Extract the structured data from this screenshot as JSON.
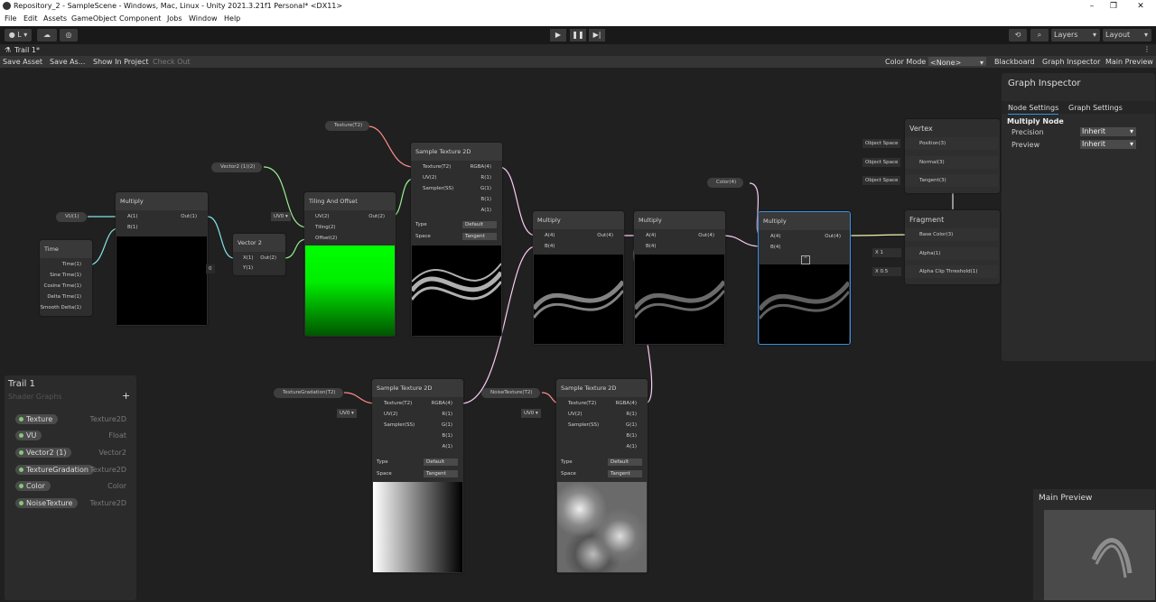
{
  "window": {
    "title": "Repository_2 - SampleScene - Windows, Mac, Linux - Unity 2021.3.21f1 Personal* <DX11>"
  },
  "menu": [
    "File",
    "Edit",
    "Assets",
    "GameObject",
    "Component",
    "Jobs",
    "Window",
    "Help"
  ],
  "toolbar": {
    "account": "L",
    "layers": "Layers",
    "layout": "Layout"
  },
  "tab": {
    "label": "Trail 1*"
  },
  "sg_toolbar": {
    "save_asset": "Save Asset",
    "save_as": "Save As...",
    "show_in_project": "Show In Project",
    "check_out": "Check Out",
    "color_mode_label": "Color Mode",
    "color_mode_value": "<None>",
    "blackboard": "Blackboard",
    "graph_inspector": "Graph Inspector",
    "main_preview": "Main Preview"
  },
  "nodes": {
    "time": {
      "title": "Time",
      "ports": [
        "Time(1)",
        "Sine Time(1)",
        "Cosine Time(1)",
        "Delta Time(1)",
        "Smooth Delta(1)"
      ]
    },
    "multiply_a": {
      "title": "Multiply",
      "in": [
        "A(1)",
        "B(1)"
      ],
      "out": "Out(1)"
    },
    "vector2": {
      "title": "Vector 2",
      "in": [
        "X(1)",
        "Y(1)"
      ],
      "out": "Out(2)",
      "y_value": "0"
    },
    "tiling": {
      "title": "Tiling And Offset",
      "in": [
        "UV(2)",
        "Tiling(2)",
        "Offset(2)"
      ],
      "out": "Out(2)",
      "uv_value": "UV0"
    },
    "sample1": {
      "title": "Sample Texture 2D",
      "in": [
        "Texture(T2)",
        "UV(2)",
        "Sampler(SS)"
      ],
      "out": [
        "RGBA(4)",
        "R(1)",
        "G(1)",
        "B(1)",
        "A(1)"
      ],
      "type_label": "Type",
      "type_value": "Default",
      "space_label": "Space",
      "space_value": "Tangent"
    },
    "multiply_b": {
      "title": "Multiply",
      "in": [
        "A(4)",
        "B(4)"
      ],
      "out": "Out(4)"
    },
    "multiply_c": {
      "title": "Multiply",
      "in": [
        "A(4)",
        "B(4)"
      ],
      "out": "Out(4)"
    },
    "multiply_d": {
      "title": "Multiply",
      "in": [
        "A(4)",
        "B(4)"
      ],
      "out": "Out(4)"
    },
    "sample2": {
      "title": "Sample Texture 2D",
      "in": [
        "Texture(T2)",
        "UV(2)",
        "Sampler(SS)"
      ],
      "out": [
        "RGBA(4)",
        "R(1)",
        "G(1)",
        "B(1)",
        "A(1)"
      ],
      "uv_value": "UV0",
      "type_label": "Type",
      "type_value": "Default",
      "space_label": "Space",
      "space_value": "Tangent"
    },
    "sample3": {
      "title": "Sample Texture 2D",
      "in": [
        "Texture(T2)",
        "UV(2)",
        "Sampler(SS)"
      ],
      "out": [
        "RGBA(4)",
        "R(1)",
        "G(1)",
        "B(1)",
        "A(1)"
      ],
      "uv_value": "UV0",
      "type_label": "Type",
      "type_value": "Default",
      "space_label": "Space",
      "space_value": "Tangent"
    }
  },
  "properties": {
    "vu": "VU(1)",
    "vector2": "Vector2 (1)(2)",
    "texture": "Texture(T2)",
    "color": "Color(4)",
    "texture_gradation": "TextureGradation(T2)",
    "noise_texture": "NoiseTexture(T2)"
  },
  "master": {
    "vertex_title": "Vertex",
    "vertex_blocks": [
      {
        "pill": "Object Space",
        "label": "Position(3)"
      },
      {
        "pill": "Object Space",
        "label": "Normal(3)"
      },
      {
        "pill": "Object Space",
        "label": "Tangent(3)"
      }
    ],
    "fragment_title": "Fragment",
    "fragment_blocks": [
      {
        "pill": "",
        "label": "Base Color(3)"
      },
      {
        "pill": "X  1",
        "label": "Alpha(1)"
      },
      {
        "pill": "X  0.5",
        "label": "Alpha Clip Threshold(1)"
      }
    ]
  },
  "inspector": {
    "title": "Graph Inspector",
    "tab_node": "Node Settings",
    "tab_graph": "Graph Settings",
    "section": "Multiply Node",
    "rows": [
      {
        "label": "Precision",
        "value": "Inherit"
      },
      {
        "label": "Preview",
        "value": "Inherit"
      }
    ]
  },
  "blackboard": {
    "title": "Trail 1",
    "subtitle": "Shader Graphs",
    "add": "+",
    "items": [
      {
        "name": "Texture",
        "type": "Texture2D"
      },
      {
        "name": "VU",
        "type": "Float"
      },
      {
        "name": "Vector2 (1)",
        "type": "Vector2"
      },
      {
        "name": "TextureGradation",
        "type": "Texture2D"
      },
      {
        "name": "Color",
        "type": "Color"
      },
      {
        "name": "NoiseTexture",
        "type": "Texture2D"
      }
    ]
  },
  "main_preview": {
    "title": "Main Preview"
  },
  "colors": {
    "bg": "#202020",
    "selected": "#3a8ee6",
    "edge_float": "#84e4e7",
    "edge_vec2": "#9aef92",
    "edge_vec4": "#fbcbf4",
    "edge_tex": "#ff8b8b"
  }
}
